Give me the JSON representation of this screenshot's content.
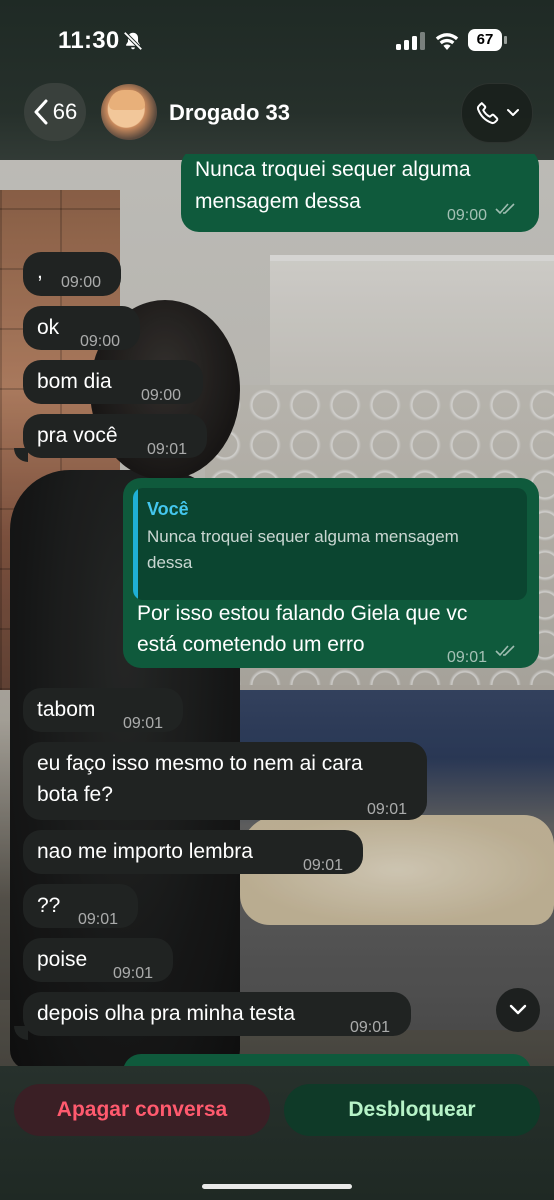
{
  "status_bar": {
    "time": "11:30",
    "battery": "67"
  },
  "header": {
    "back_count": "66",
    "contact_name": "Drogado 33"
  },
  "messages": [
    {
      "dir": "out",
      "text_line1": "Nunca troquei sequer alguma",
      "text_line2": "mensagem dessa",
      "time": "09:00",
      "read": true
    },
    {
      "dir": "in",
      "text": ",",
      "time": "09:00"
    },
    {
      "dir": "in",
      "text": "ok",
      "time": "09:00"
    },
    {
      "dir": "in",
      "text": "bom dia",
      "time": "09:00"
    },
    {
      "dir": "in",
      "text": "pra você",
      "time": "09:01"
    },
    {
      "dir": "out",
      "quote_author": "Você",
      "quote_line1": "Nunca troquei sequer alguma mensagem",
      "quote_line2": "dessa",
      "text_line1": "Por isso estou falando Giela que vc",
      "text_line2": "está cometendo um erro",
      "time": "09:01",
      "read": true
    },
    {
      "dir": "in",
      "text": "tabom",
      "time": "09:01"
    },
    {
      "dir": "in",
      "text_line1": "eu faço isso mesmo to nem ai cara",
      "text_line2": "bota fe?",
      "time": "09:01"
    },
    {
      "dir": "in",
      "text": "nao me importo lembra",
      "time": "09:01"
    },
    {
      "dir": "in",
      "text": "??",
      "time": "09:01"
    },
    {
      "dir": "in",
      "text": "poise",
      "time": "09:01"
    },
    {
      "dir": "in",
      "text": "depois olha pra minha testa",
      "time": "09:01"
    }
  ],
  "actions": {
    "delete_label": "Apagar conversa",
    "unblock_label": "Desbloquear"
  },
  "colors": {
    "outgoing": "#0f5a3c",
    "incoming": "#202322",
    "delete_text": "#ff5a6e",
    "unblock_text": "#b7f3c8",
    "quote_author": "#44c7ee"
  },
  "icons": [
    "bell-slash-icon",
    "signal-icon",
    "wifi-icon",
    "battery-icon",
    "chevron-left-icon",
    "phone-icon",
    "chevron-down-icon",
    "double-check-icon"
  ]
}
